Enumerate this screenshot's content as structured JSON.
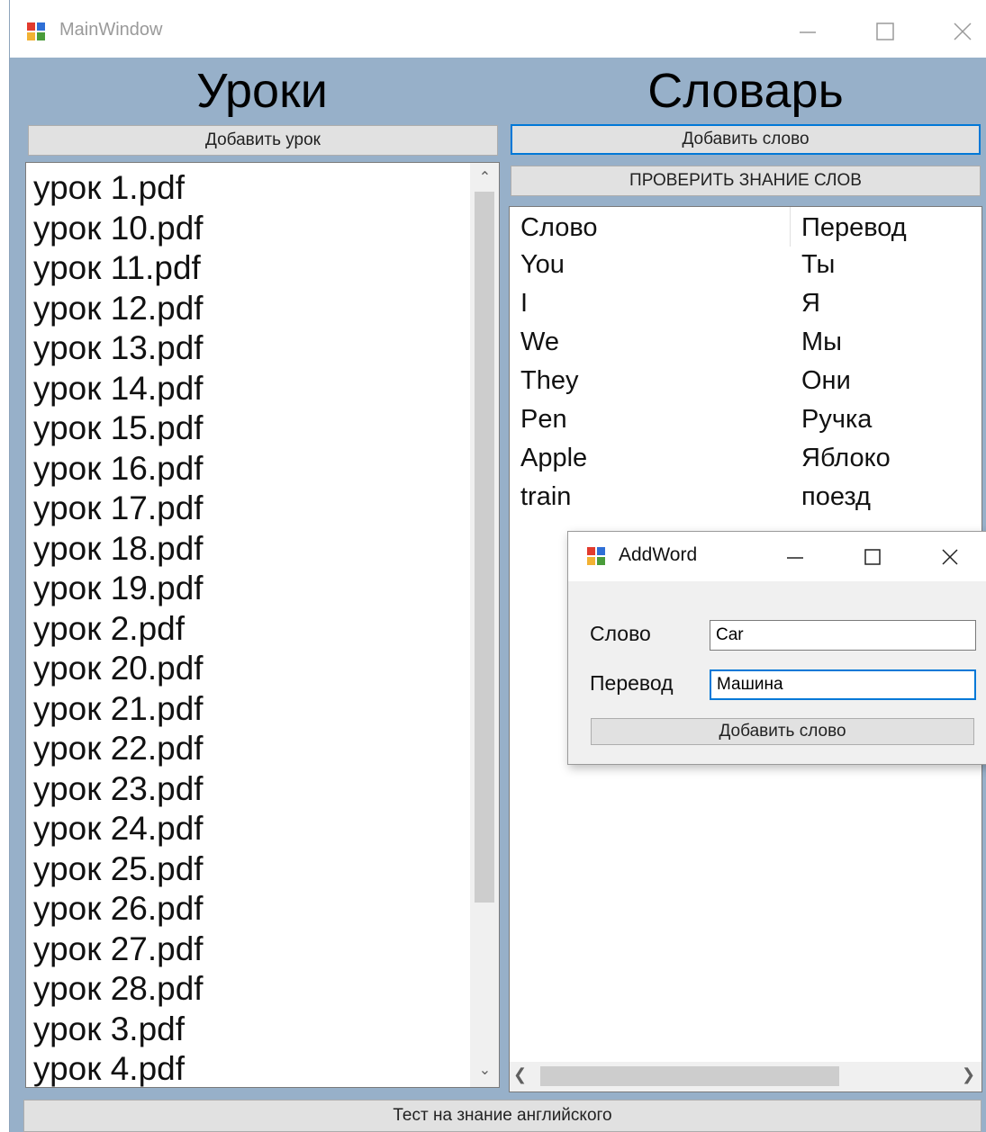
{
  "window": {
    "title": "MainWindow",
    "icon": "winforms-app-icon"
  },
  "lessons": {
    "heading": "Уроки",
    "add_button": "Добавить урок",
    "items": [
      "урок 1.pdf",
      "урок 10.pdf",
      "урок 11.pdf",
      "урок 12.pdf",
      "урок 13.pdf",
      "урок 14.pdf",
      "урок 15.pdf",
      "урок 16.pdf",
      "урок 17.pdf",
      "урок 18.pdf",
      "урок 19.pdf",
      "урок 2.pdf",
      "урок 20.pdf",
      "урок 21.pdf",
      "урок 22.pdf",
      "урок 23.pdf",
      "урок 24.pdf",
      "урок 25.pdf",
      "урок 26.pdf",
      "урок 27.pdf",
      "урок 28.pdf",
      "урок 3.pdf",
      "урок 4.pdf"
    ]
  },
  "dictionary": {
    "heading": "Словарь",
    "add_button": "Добавить слово",
    "check_button": "ПРОВЕРИТЬ ЗНАНИЕ СЛОВ",
    "columns": [
      "Слово",
      "Перевод"
    ],
    "rows": [
      [
        "You",
        "Ты"
      ],
      [
        "I",
        "Я"
      ],
      [
        "We",
        "Мы"
      ],
      [
        "They",
        "Они"
      ],
      [
        "Pen",
        "Ручка"
      ],
      [
        "Apple",
        "Яблоко"
      ],
      [
        "train",
        "поезд"
      ]
    ]
  },
  "footer": {
    "button": "Тест на знание английского"
  },
  "addword_dialog": {
    "title": "AddWord",
    "word_label": "Слово",
    "word_value": "Car",
    "translation_label": "Перевод",
    "translation_value": "Машина",
    "submit_button": "Добавить слово"
  },
  "colors": {
    "form_background": "#97b0c9",
    "focus_border": "#0078d7",
    "button_face": "#e1e1e1"
  }
}
